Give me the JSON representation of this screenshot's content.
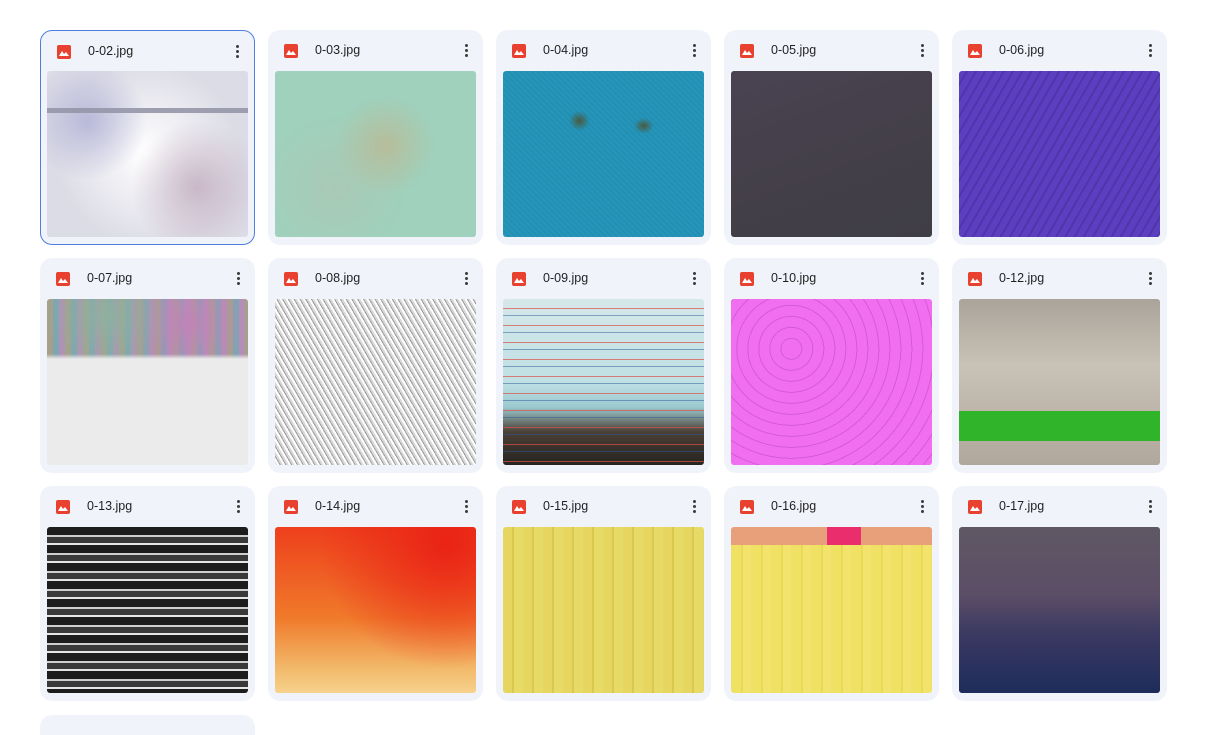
{
  "files": [
    {
      "name": "0-02.jpg",
      "selected": true
    },
    {
      "name": "0-03.jpg",
      "selected": false
    },
    {
      "name": "0-04.jpg",
      "selected": false
    },
    {
      "name": "0-05.jpg",
      "selected": false
    },
    {
      "name": "0-06.jpg",
      "selected": false
    },
    {
      "name": "0-07.jpg",
      "selected": false
    },
    {
      "name": "0-08.jpg",
      "selected": false
    },
    {
      "name": "0-09.jpg",
      "selected": false
    },
    {
      "name": "0-10.jpg",
      "selected": false
    },
    {
      "name": "0-12.jpg",
      "selected": false
    },
    {
      "name": "0-13.jpg",
      "selected": false
    },
    {
      "name": "0-14.jpg",
      "selected": false
    },
    {
      "name": "0-15.jpg",
      "selected": false
    },
    {
      "name": "0-16.jpg",
      "selected": false
    },
    {
      "name": "0-17.jpg",
      "selected": false
    }
  ],
  "icons": {
    "file_type": "image-file-icon",
    "menu": "more-vert-icon"
  },
  "colors": {
    "card_bg": "#f1f3fb",
    "image_icon": "#e8412f",
    "selected_border": "#4c7ddf"
  }
}
